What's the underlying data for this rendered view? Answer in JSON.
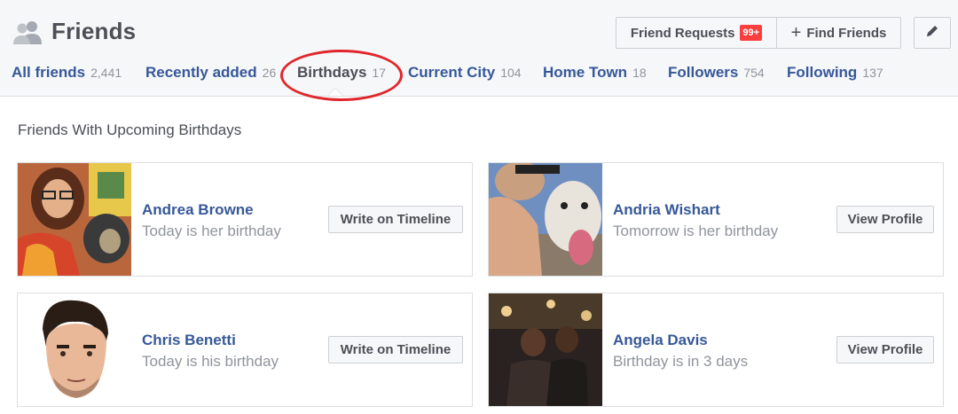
{
  "header": {
    "title": "Friends",
    "friend_requests_label": "Friend Requests",
    "friend_requests_badge": "99+",
    "find_friends_label": "Find Friends",
    "find_friends_icon": "+"
  },
  "tabs": [
    {
      "label": "All friends",
      "count": "2,441"
    },
    {
      "label": "Recently added",
      "count": "26"
    },
    {
      "label": "Birthdays",
      "count": "17",
      "active": true
    },
    {
      "label": "Current City",
      "count": "104"
    },
    {
      "label": "Home Town",
      "count": "18"
    },
    {
      "label": "Followers",
      "count": "754"
    },
    {
      "label": "Following",
      "count": "137"
    }
  ],
  "section": {
    "title": "Friends With Upcoming Birthdays"
  },
  "cards": [
    {
      "name": "Andrea Browne",
      "birthday": "Today is her birthday",
      "action": "Write on Timeline"
    },
    {
      "name": "Andria Wishart",
      "birthday": "Tomorrow is her birthday",
      "action": "View Profile"
    },
    {
      "name": "Chris Benetti",
      "birthday": "Today is his birthday",
      "action": "Write on Timeline"
    },
    {
      "name": "Angela Davis",
      "birthday": "Birthday is in 3 days",
      "action": "View Profile"
    }
  ],
  "colors": {
    "link": "#365899",
    "badge": "#fa3e3e",
    "highlight": "#e0262b",
    "header_bg": "#f6f7f9"
  },
  "icons": {
    "friends": "friends-icon",
    "edit": "pencil-icon",
    "find": "plus-icon"
  }
}
